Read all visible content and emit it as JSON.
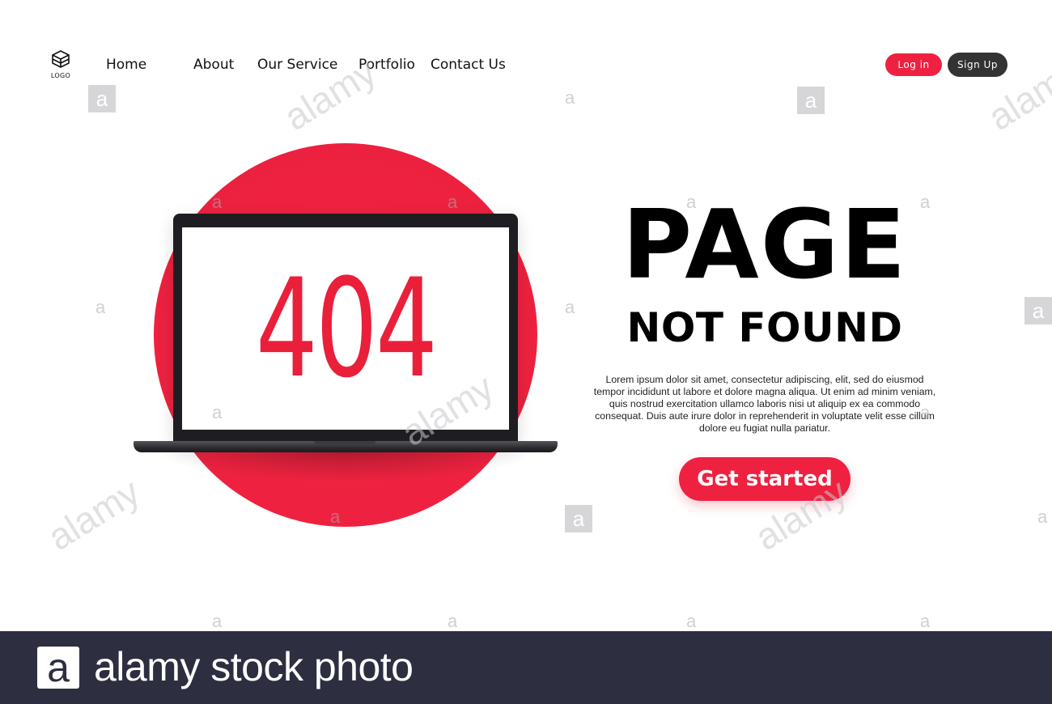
{
  "header": {
    "logo_label": "LOGO",
    "nav": [
      {
        "label": "Home"
      },
      {
        "label": "About"
      },
      {
        "label": "Our Service"
      },
      {
        "label": "Portfolio"
      },
      {
        "label": "Contact Us"
      }
    ],
    "login_label": "Log in",
    "signup_label": "Sign Up"
  },
  "hero": {
    "error_code": "404",
    "title": "PAGE",
    "subtitle": "NOT FOUND",
    "body_lines": [
      "Lorem ipsum dolor sit amet, consectetur adipiscing, elit, sed do eiusmod",
      "tempor incididunt ut labore et dolore magna aliqua. Ut enim ad minim veniam,",
      "quis nostrud exercitation ullamco laboris nisi ut aliquip ex ea commodo",
      "consequat. Duis aute irure dolor in reprehenderit in voluptate velit esse cillum",
      "dolore eu fugiat nulla pariatur."
    ],
    "cta_label": "Get started"
  },
  "watermark": {
    "mark_glyph": "a",
    "word": "alamy"
  },
  "footer": {
    "logo_glyph": "a",
    "text": "alamy stock photo"
  },
  "colors": {
    "accent": "#ee2240",
    "dark_button": "#333333",
    "footer_bg": "#2d2e40",
    "text": "#000000"
  },
  "icons": {
    "logo": "stacked-cubes-icon"
  }
}
